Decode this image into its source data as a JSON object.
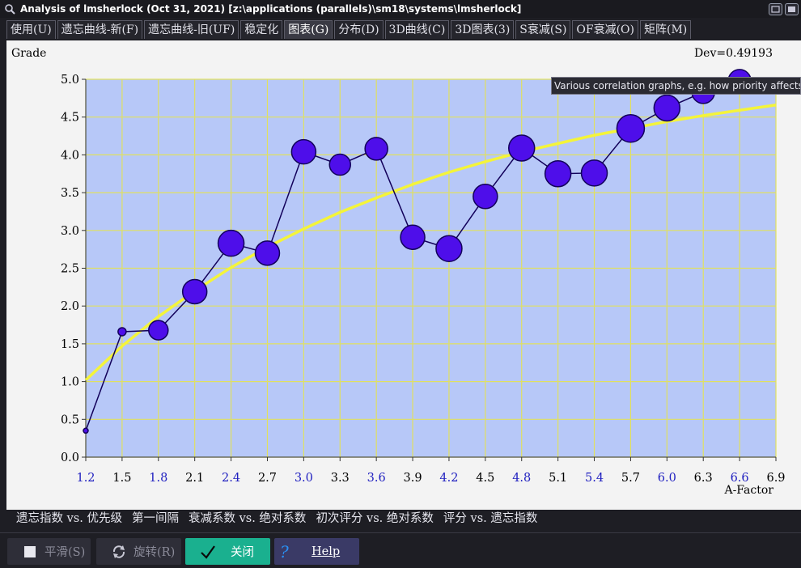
{
  "window": {
    "title": "Analysis of lmsherlock (Oct 31, 2021) [z:\\applications (parallels)\\sm18\\systems\\lmsherlock]"
  },
  "tabs": [
    {
      "label": "使用(U)",
      "active": false
    },
    {
      "label": "遗忘曲线-新(F)",
      "active": false
    },
    {
      "label": "遗忘曲线-旧(UF)",
      "active": false
    },
    {
      "label": "稳定化",
      "active": false
    },
    {
      "label": "图表(G)",
      "active": true
    },
    {
      "label": "分布(D)",
      "active": false
    },
    {
      "label": "3D曲线(C)",
      "active": false
    },
    {
      "label": "3D图表(3)",
      "active": false
    },
    {
      "label": "S衰减(S)",
      "active": false
    },
    {
      "label": "OF衰减(O)",
      "active": false
    },
    {
      "label": "矩阵(M)",
      "active": false
    }
  ],
  "tooltip": "Various correlation graphs, e.g. how priority affects retention",
  "chart_data": {
    "type": "scatter",
    "ylabel": "Grade",
    "xlabel": "A-Factor",
    "stat": "Dev=0.49193",
    "xlim": [
      1.2,
      6.9
    ],
    "ylim": [
      0,
      5
    ],
    "xticks": [
      "1.2",
      "1.5",
      "1.8",
      "2.1",
      "2.4",
      "2.7",
      "3.0",
      "3.3",
      "3.6",
      "3.9",
      "4.2",
      "4.5",
      "4.8",
      "5.1",
      "5.4",
      "5.7",
      "6.0",
      "6.3",
      "6.6",
      "6.9"
    ],
    "yticks": [
      "0.0",
      "0.5",
      "1.0",
      "1.5",
      "2.0",
      "2.5",
      "3.0",
      "3.5",
      "4.0",
      "4.5",
      "5.0"
    ],
    "grid": true,
    "series": [
      {
        "x": [
          1.2,
          1.5,
          1.8,
          2.1,
          2.4,
          2.7,
          3.0,
          3.3,
          3.6,
          3.9,
          4.2,
          4.5,
          4.8,
          5.1,
          5.4,
          5.7,
          6.0,
          6.3,
          6.6
        ],
        "y": [
          0.35,
          1.66,
          1.68,
          2.19,
          2.83,
          2.7,
          4.04,
          3.87,
          4.08,
          2.91,
          2.76,
          3.45,
          4.09,
          3.75,
          3.76,
          4.35,
          4.62,
          4.83,
          4.98
        ],
        "marker_sizes": [
          3,
          5,
          12,
          15,
          16,
          15,
          15,
          13,
          14,
          15,
          16,
          15,
          16,
          16,
          16,
          17,
          16,
          14,
          14
        ]
      }
    ],
    "fit_curve": {
      "x": [
        1.2,
        1.5,
        1.8,
        2.1,
        2.4,
        2.7,
        3.0,
        3.3,
        3.6,
        3.9,
        4.2,
        4.5,
        4.8,
        5.1,
        5.4,
        5.7,
        6.0,
        6.3,
        6.6,
        6.9
      ],
      "y": [
        1.02,
        1.47,
        1.86,
        2.2,
        2.51,
        2.78,
        3.02,
        3.24,
        3.43,
        3.61,
        3.77,
        3.91,
        4.04,
        4.15,
        4.26,
        4.35,
        4.44,
        4.52,
        4.59,
        4.66
      ]
    },
    "colors": {
      "plot_bg": "#b7c8f8",
      "grid": "#e0e060",
      "marker_fill": "#4e0eea",
      "marker_stroke": "#12005a",
      "fit_line": "#f4f43a",
      "axis_text_highlight": "#2020c0",
      "axis_text": "#000000"
    }
  },
  "graph_links": [
    "遗忘指数 vs. 优先级",
    "第一间隔",
    "衰减系数 vs. 绝对系数",
    "初次评分 vs. 绝对系数",
    "评分 vs. 遗忘指数"
  ],
  "buttons": {
    "smooth": {
      "label": "平滑(S)"
    },
    "rotate": {
      "label": "旋转(R)"
    },
    "close": {
      "label": "关闭"
    },
    "help": {
      "label": "Help"
    }
  }
}
